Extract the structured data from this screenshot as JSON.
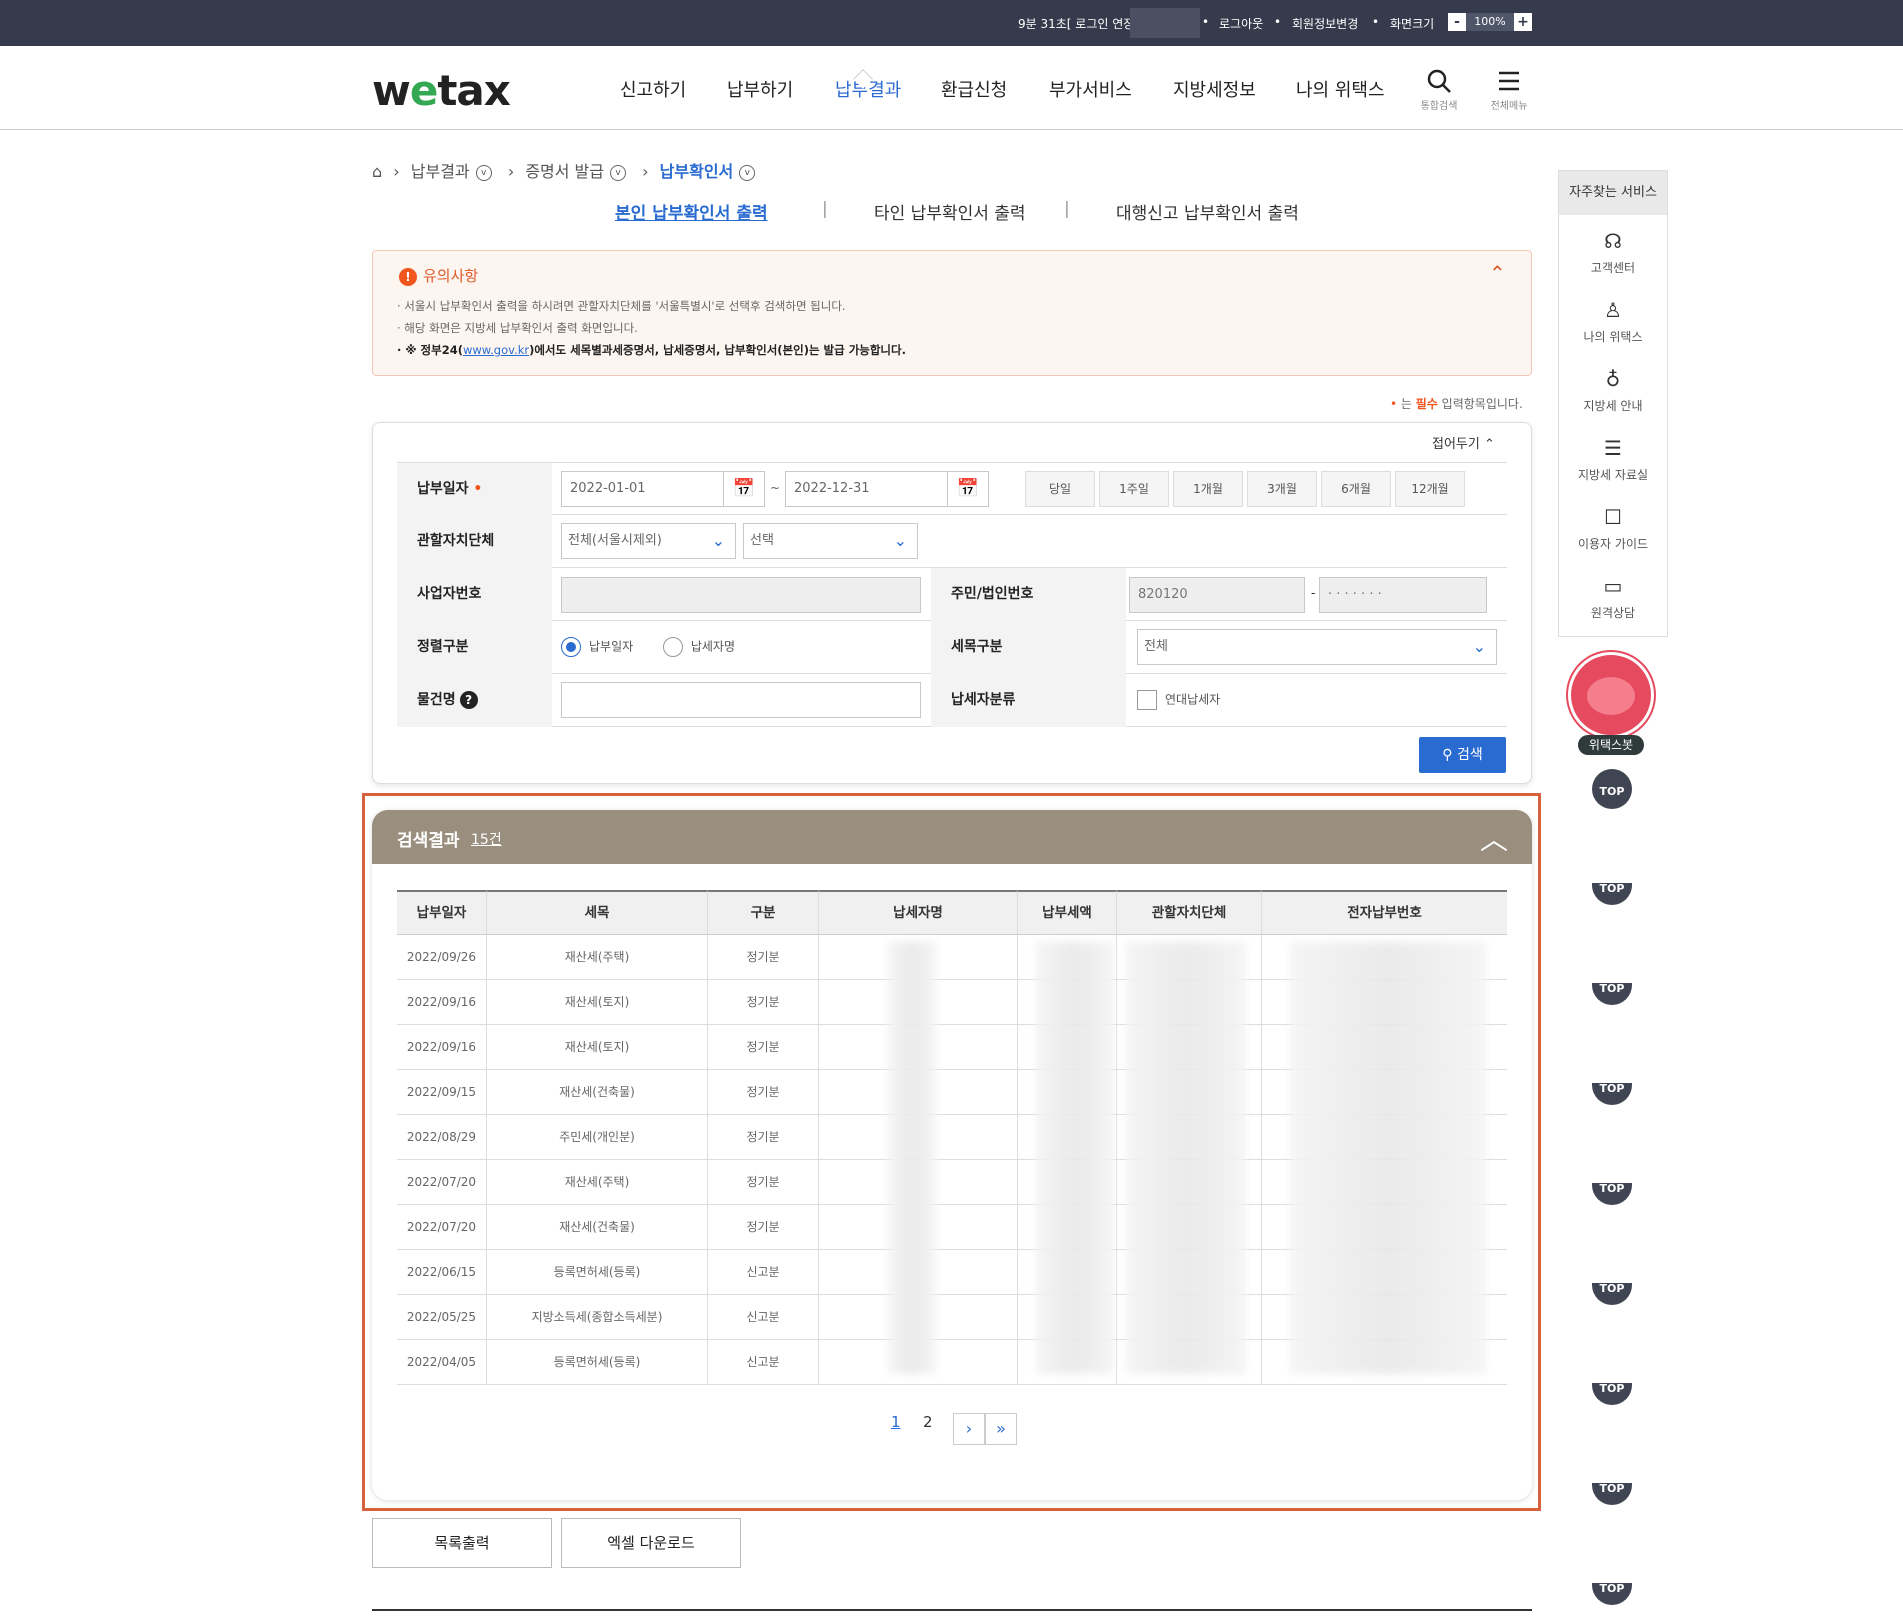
{
  "topbar": {
    "timer": "9분 31초[ 로그인 연장",
    "logout": "로그아웃",
    "member_change": "회원정보변경",
    "screen_size": "화면크기",
    "zoom": "100%",
    "minus": "-",
    "plus": "+"
  },
  "header": {
    "logo_w": "w",
    "logo_e": "e",
    "logo_tax": "tax",
    "nav": [
      "신고하기",
      "납부하기",
      "납부결과",
      "환급신청",
      "부가서비스",
      "지방세정보",
      "나의 위택스"
    ],
    "search_label": "통합검색",
    "menu_label": "전체메뉴"
  },
  "breadcrumb": {
    "items": [
      "납부결과",
      "증명서 발급",
      "납부확인서"
    ]
  },
  "subtabs": [
    "본인 납부확인서 출력",
    "타인 납부확인서 출력",
    "대행신고 납부확인서 출력"
  ],
  "notice": {
    "title": "유의사항",
    "line1": "· 서울시 납부확인서 출력을 하시려면 관할자치단체를 '서울특별시'로 선택후 검색하면 됩니다.",
    "line2": "· 해당 화면은 지방세 납부확인서 출력 화면입니다.",
    "line3_prefix": "· ※ 정부24(",
    "line3_link": "www.gov.kr",
    "line3_suffix": ")에서도 세목별과세증명서, 납세증명서, 납부확인서(본인)는 발급 가능합니다."
  },
  "required_note": {
    "dot": "•",
    "pre": " 는 ",
    "word": "필수",
    "post": " 입력항목입니다."
  },
  "search": {
    "fold": "접어두기",
    "pay_date_label": "납부일자",
    "date_from": "2022-01-01",
    "date_to": "2022-12-31",
    "periods": [
      "당일",
      "1주일",
      "1개월",
      "3개월",
      "6개월",
      "12개월"
    ],
    "region_label": "관할자치단체",
    "region1": "전체(서울시제외)",
    "region2": "선택",
    "biz_label": "사업자번호",
    "id_label": "주민/법인번호",
    "id_front": "820120",
    "id_back": "· · · · · · ·",
    "sort_label": "정렬구분",
    "sort_opt1": "납부일자",
    "sort_opt2": "납세자명",
    "tax_type_label": "세목구분",
    "tax_type": "전체",
    "item_label": "물건명",
    "taxpayer_type_label": "납세자분류",
    "joint_label": "연대납세자",
    "search_btn": "검색"
  },
  "results": {
    "title": "검색결과",
    "count": "15건",
    "columns": [
      "납부일자",
      "세목",
      "구분",
      "납세자명",
      "납부세액",
      "관할자치단체",
      "전자납부번호"
    ],
    "rows": [
      [
        "2022/09/26",
        "재산세(주택)",
        "정기분"
      ],
      [
        "2022/09/16",
        "재산세(토지)",
        "정기분"
      ],
      [
        "2022/09/16",
        "재산세(토지)",
        "정기분"
      ],
      [
        "2022/09/15",
        "재산세(건축물)",
        "정기분"
      ],
      [
        "2022/08/29",
        "주민세(개인분)",
        "정기분"
      ],
      [
        "2022/07/20",
        "재산세(주택)",
        "정기분"
      ],
      [
        "2022/07/20",
        "재산세(건축물)",
        "정기분"
      ],
      [
        "2022/06/15",
        "등록면허세(등록)",
        "신고분"
      ],
      [
        "2022/05/25",
        "지방소득세(종합소득세분)",
        "신고분"
      ],
      [
        "2022/04/05",
        "등록면허세(등록)",
        "신고분"
      ]
    ],
    "pages": [
      "1",
      "2"
    ]
  },
  "bottom_buttons": [
    "목록출력",
    "엑셀 다운로드"
  ],
  "quick": {
    "title": "자주찾는 서비스",
    "items": [
      "고객센터",
      "나의 위택스",
      "지방세 안내",
      "지방세 자료실",
      "이용자 가이드",
      "원격상담"
    ]
  },
  "bot_label": "위택스봇",
  "top_label": "TOP"
}
